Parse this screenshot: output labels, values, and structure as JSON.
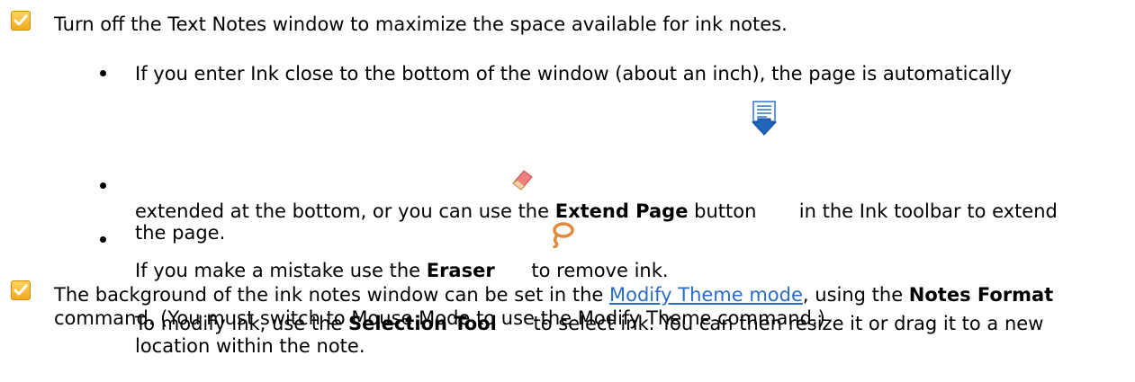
{
  "items": {
    "tip1": {
      "text": "Turn off the Text Notes window to maximize the space available for ink notes."
    },
    "bullet1": {
      "line1": "If you enter Ink close to the bottom of the window (about an inch), the page is automatically",
      "line2_pre": "extended at the bottom, or you can use the ",
      "line2_bold": "Extend Page",
      "line2_mid": " button ",
      "line2_post": " in the Ink toolbar to extend",
      "line3": "the page."
    },
    "bullet2": {
      "pre": "If you make a mistake use the ",
      "bold": "Eraser",
      "post": " to remove ink."
    },
    "bullet3": {
      "pre": "To modify ink, use the ",
      "bold": "Selection Tool",
      "post": " to select ink. You can then resize it or drag it to a new",
      "line2": "location within the note."
    },
    "tip2": {
      "line1_pre": "The background of the ink notes window can be set in the ",
      "link": "Modify Theme mode",
      "line1_mid": ", using the ",
      "line1_bold": "Notes Format",
      "line2": "command. (You must switch to Mouse Mode to use the Modify Theme command.)"
    }
  },
  "icons": {
    "checkbox": "checkmark-icon",
    "extend_page": "extend-page-icon",
    "eraser": "eraser-icon",
    "selection_tool": "lasso-selection-icon"
  },
  "colors": {
    "checkbox": "#f5b731",
    "link": "#2b6cc4",
    "text": "#000000"
  }
}
